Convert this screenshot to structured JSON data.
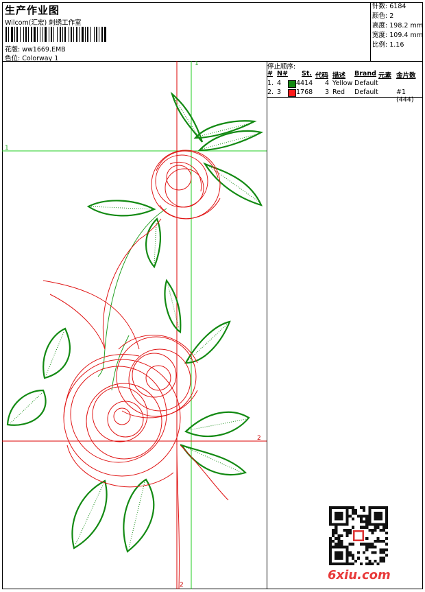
{
  "header": {
    "title": "生产作业图",
    "company": "Wilcom(汇宏) 刺绣工作室",
    "design_label": "花版:",
    "design_value": "ww1669.EMB",
    "colorway_label": "色位:",
    "colorway_value": "Colorway 1"
  },
  "stats": [
    {
      "label": "针数:",
      "value": "6184"
    },
    {
      "label": "颜色:",
      "value": "2"
    },
    {
      "label": "高度:",
      "value": "198.2 mm"
    },
    {
      "label": "宽度:",
      "value": "109.4 mm"
    },
    {
      "label": "比例:",
      "value": "1.16"
    }
  ],
  "stop_sequence": {
    "title": "停止顺序:",
    "headers": [
      "#",
      "N#",
      "St.",
      "代码",
      "描述",
      "Brand",
      "元素",
      "金片数"
    ],
    "rows": [
      {
        "num": "1.",
        "n": "4",
        "color": "#138a13",
        "stitches": "4414",
        "code": "4",
        "desc": "Yellow",
        "brand": "Default",
        "element": "",
        "sequin": ""
      },
      {
        "num": "2.",
        "n": "3",
        "color": "#ff1a1a",
        "stitches": "1768",
        "code": "3",
        "desc": "Red",
        "brand": "Default",
        "element": "",
        "sequin": "#1 (444)"
      }
    ]
  },
  "guides": {
    "green_v_label": "1",
    "green_h_label": "1",
    "red_h_label": "2",
    "red_v_label": "2"
  },
  "colors": {
    "leaf_green": "#138a13",
    "rose_red": "#e01515",
    "guide_green": "#22cc22",
    "guide_red": "#dd0000"
  },
  "watermark": {
    "logo": "6xiu.com"
  }
}
